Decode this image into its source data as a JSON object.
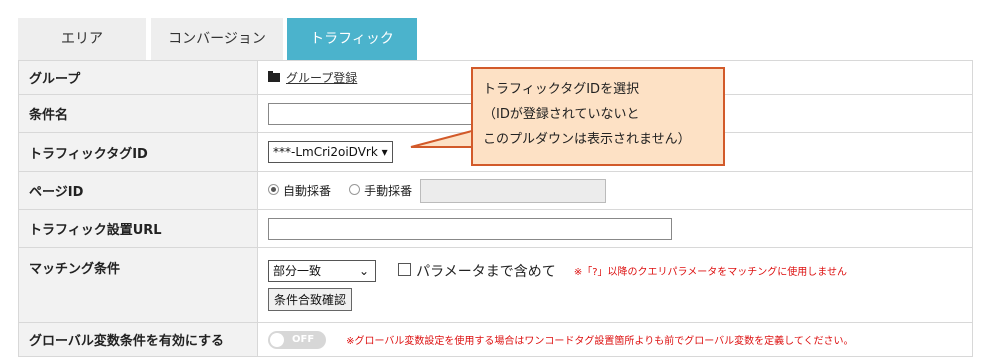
{
  "tabs": [
    {
      "label": "エリア",
      "active": false
    },
    {
      "label": "コンバージョン",
      "active": false
    },
    {
      "label": "トラフィック",
      "active": true
    }
  ],
  "rows": {
    "group": {
      "label": "グループ",
      "link": "グループ登録",
      "icon": "folder-icon"
    },
    "condition_name": {
      "label": "条件名",
      "value": ""
    },
    "traffic_tag": {
      "label": "トラフィックタグID",
      "selected": "***-LmCri2oiDVrk ▾"
    },
    "page_id": {
      "label": "ページID",
      "option_auto": "自動採番",
      "option_manual": "手動採番",
      "selected": "自動採番",
      "manual_value": ""
    },
    "url": {
      "label": "トラフィック設置URL",
      "value": ""
    },
    "matching": {
      "label": "マッチング条件",
      "selected": "部分一致",
      "param_label": "パラメータまで含めて",
      "param_checked": false,
      "note": "※「?」以降のクエリパラメータをマッチングに使用しません",
      "confirm_button": "条件合致確認"
    },
    "global": {
      "label": "グローバル変数条件を有効にする",
      "toggle_label": "OFF",
      "toggle_on": false,
      "note": "※グローバル変数設定を使用する場合はワンコードタグ設置箇所よりも前でグローバル変数を定義してください。"
    }
  },
  "callout": {
    "line1": "トラフィックタグIDを選択",
    "line2": "（IDが登録されていないと",
    "line3": "このプルダウンは表示されません）"
  },
  "colors": {
    "tab_active": "#4bb3cc",
    "tab_inactive": "#eeeeee",
    "callout_fill": "#fde1c5",
    "callout_border": "#d25a2a",
    "note_red": "#dd1111"
  }
}
